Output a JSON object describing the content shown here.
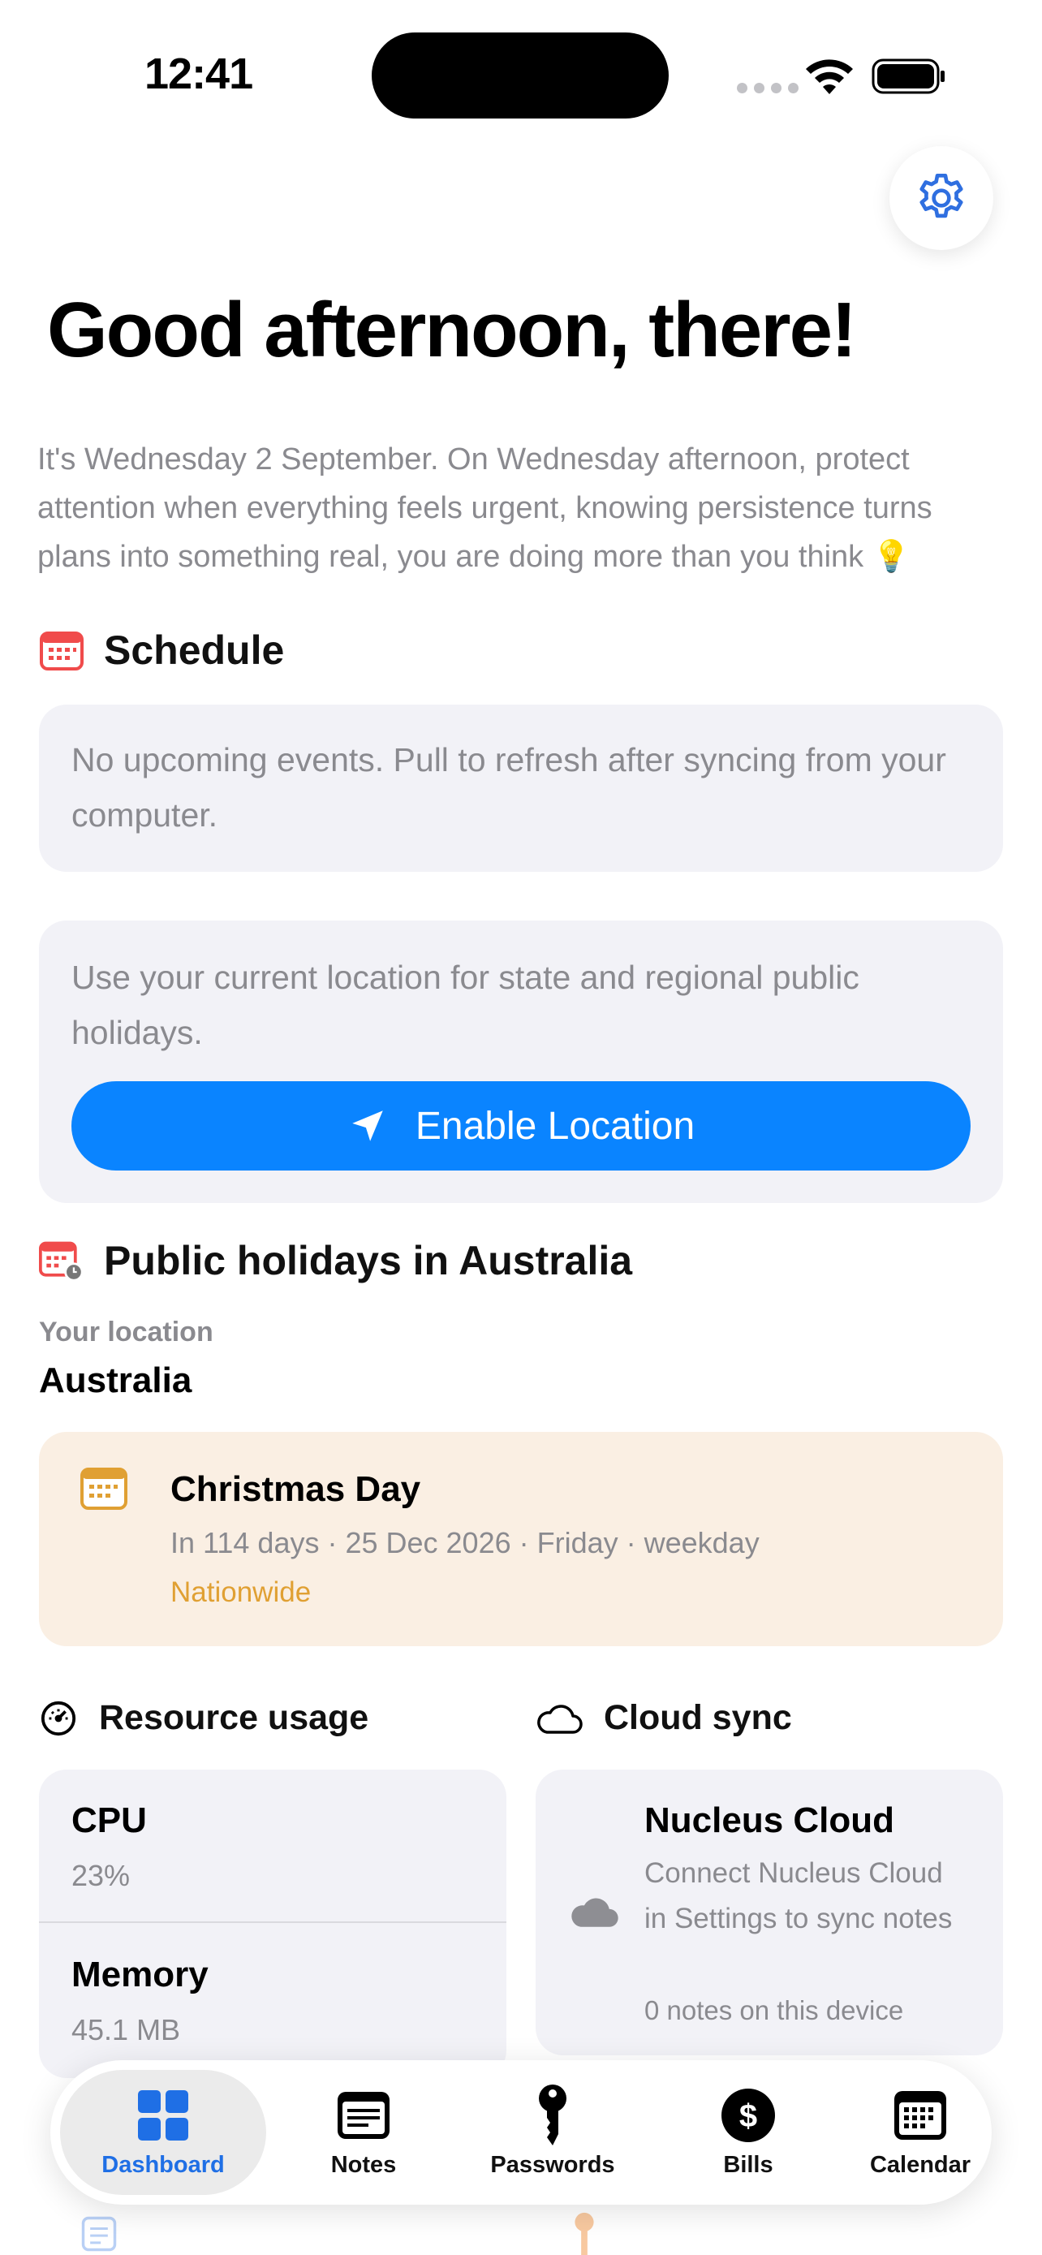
{
  "status": {
    "time": "12:41"
  },
  "greeting": "Good afternoon, there!",
  "intro": "It's Wednesday 2 September. On Wednesday afternoon, protect attention when everything feels urgent, knowing persistence turns plans into something real, you are doing more than you think 💡",
  "schedule": {
    "title": "Schedule",
    "empty_text": "No upcoming events. Pull to refresh after syncing from your computer."
  },
  "location": {
    "prompt": "Use your current location for state and regional public holidays.",
    "button_label": "Enable Location"
  },
  "holidays": {
    "title": "Public holidays in Australia",
    "location_label": "Your location",
    "location_value": "Australia",
    "next": {
      "name": "Christmas Day",
      "meta": "In 114 days · 25 Dec 2026 · Friday · weekday",
      "region": "Nationwide"
    }
  },
  "resources": {
    "title": "Resource usage",
    "cpu_label": "CPU",
    "cpu_value": "23%",
    "memory_label": "Memory",
    "memory_value": "45.1 MB"
  },
  "cloud": {
    "title": "Cloud sync",
    "service": "Nucleus Cloud",
    "description": "Connect Nucleus Cloud in Settings to sync notes",
    "count": "0 notes on this device"
  },
  "tabs": [
    {
      "label": "Dashboard",
      "icon": "dashboard-grid-icon",
      "active": true
    },
    {
      "label": "Notes",
      "icon": "notes-icon"
    },
    {
      "label": "Passwords",
      "icon": "key-icon"
    },
    {
      "label": "Bills",
      "icon": "dollar-icon"
    },
    {
      "label": "Calendar",
      "icon": "calendar-icon"
    }
  ],
  "colors": {
    "accent": "#0A84FF",
    "settings_blue": "#2F6FE0",
    "schedule_red": "#F04B4B",
    "holiday_orange": "#E0A033",
    "card_bg": "#F2F2F7",
    "holiday_bg": "#FAEFE3"
  }
}
